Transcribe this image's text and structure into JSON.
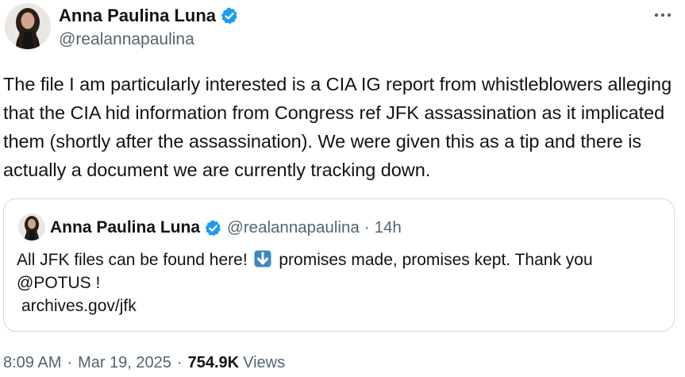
{
  "tweet": {
    "author": {
      "display_name": "Anna Paulina Luna",
      "handle": "@realannapaulina",
      "verified": true
    },
    "text": "The file I am particularly interested is a CIA IG report from whistleblowers alleging that the CIA hid information from Congress ref JFK assassination as it implicated them (shortly after the assassination). We were given this as a tip and there is actually a document we are currently tracking down.",
    "more_icon": "more-horizontal-icon",
    "quote": {
      "display_name": "Anna Paulina Luna",
      "handle": "@realannapaulina",
      "separator": "·",
      "time": "14h",
      "text_before_emoji": "All JFK files can be found here!",
      "emoji": "down-arrow-emoji",
      "text_after_emoji": "promises made, promises kept. Thank you",
      "mention": "@POTUS !",
      "link": "archives.gov/jfk"
    },
    "footer": {
      "time": "8:09 AM",
      "separator": "·",
      "date": "Mar 19, 2025",
      "separator2": "·",
      "views_count": "754.9K",
      "views_label": "Views"
    },
    "colors": {
      "text": "#0f1419",
      "secondary": "#536471",
      "verified_blue": "#1d9bf0",
      "border": "#cfd9de"
    }
  }
}
